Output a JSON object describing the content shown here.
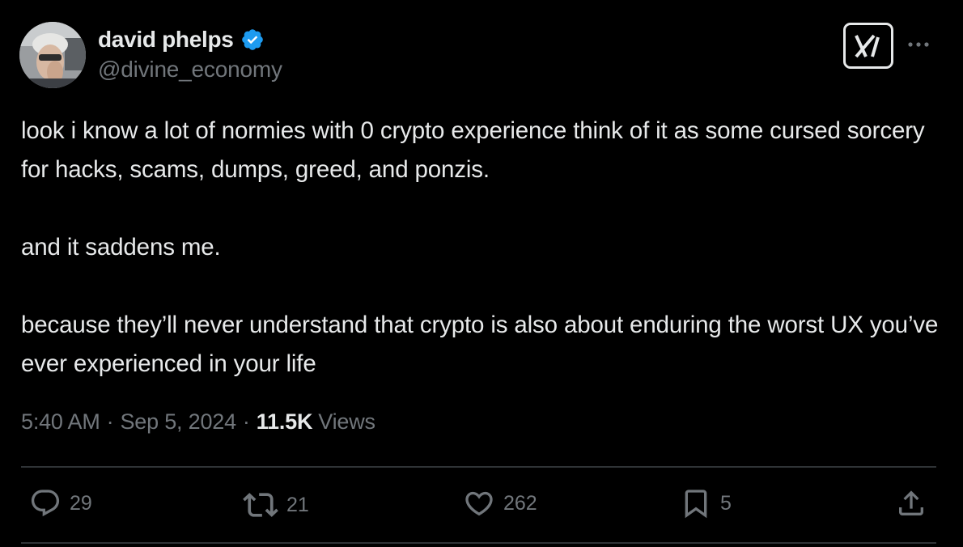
{
  "author": {
    "name": "david phelps",
    "handle": "@divine_economy",
    "verified": true,
    "verified_color": "#1d9bf0"
  },
  "header": {
    "grok_icon": "grok-x-icon",
    "more_icon": "more-dots-icon"
  },
  "tweet": {
    "paragraphs": [
      "look i know a lot of normies with 0 crypto experience think of it as some cursed sorcery for hacks, scams, dumps, greed, and ponzis.",
      "and it saddens me.",
      "because they’ll never understand that crypto is also about enduring the worst UX you’ve ever experienced in your life"
    ]
  },
  "meta": {
    "time": "5:40 AM",
    "separator": "·",
    "date": "Sep 5, 2024",
    "views_count": "11.5K",
    "views_label": "Views"
  },
  "actions": {
    "replies": "29",
    "reposts": "21",
    "likes": "262",
    "bookmarks": "5"
  },
  "colors": {
    "background": "#000000",
    "text": "#e7e9ea",
    "muted": "#71767b",
    "divider": "#2f3336"
  }
}
